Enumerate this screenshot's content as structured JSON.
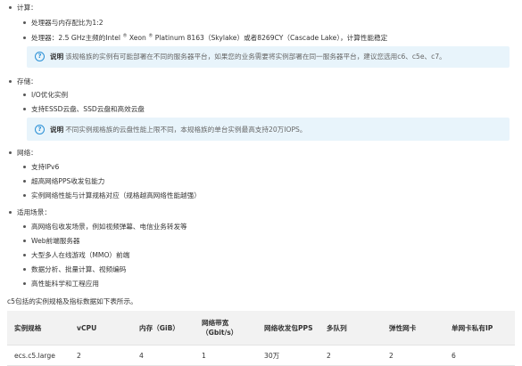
{
  "compute": {
    "heading": "计算：",
    "items": [
      "处理器与内存配比为1:2",
      "处理器：2.5 GHz主频的Intel ® Xeon ® Platinum 8163（Skylake）或者8269CY（Cascade Lake），计算性能稳定"
    ],
    "note_label": "说明",
    "note_text": "该规格族的实例有可能部署在不同的服务器平台，如果您的业务需要将实例部署在同一服务器平台，建议您选用c6、c5e、c7。"
  },
  "storage": {
    "heading": "存储：",
    "items": [
      "I/O优化实例",
      "支持ESSD云盘、SSD云盘和高效云盘"
    ],
    "note_label": "说明",
    "note_text": "不同实例规格族的云盘性能上限不同，本规格族的单台实例最高支持20万IOPS。"
  },
  "network": {
    "heading": "网络：",
    "items": [
      "支持IPv6",
      "超高网络PPS收发包能力",
      "实例网络性能与计算规格对应（规格越高网络性能越强）"
    ]
  },
  "scenarios": {
    "heading": "适用场景：",
    "items": [
      "高网络包收发场景，例如视频弹幕、电信业务转发等",
      "Web前端服务器",
      "大型多人在线游戏（MMO）前端",
      "数据分析、批量计算、视频编码",
      "高性能科学和工程应用"
    ]
  },
  "intro": "c5包括的实例规格及指标数据如下表所示。",
  "table": {
    "headers": [
      "实例规格",
      "vCPU",
      "内存（GiB）",
      "网络带宽\n（Gbit/s）",
      "网络收发包PPS",
      "多队列",
      "弹性网卡",
      "单网卡私有IP"
    ],
    "rows": [
      [
        "ecs.c5.large",
        "2",
        "4",
        "1",
        "30万",
        "2",
        "2",
        "6"
      ]
    ]
  }
}
